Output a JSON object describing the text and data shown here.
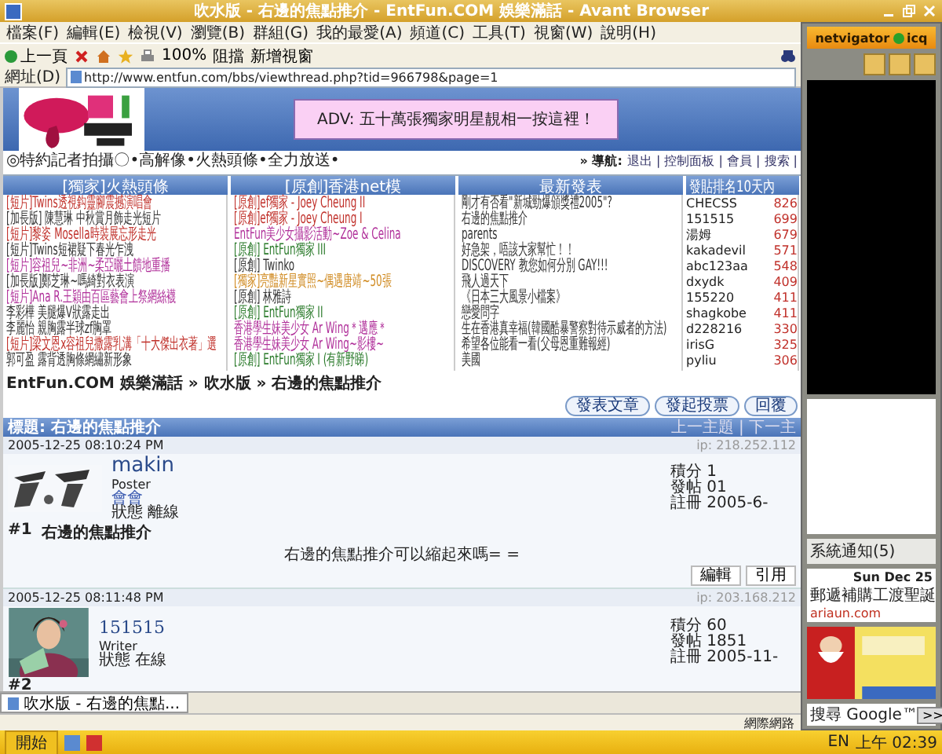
{
  "window": {
    "title": "吹水版 - 右邊的焦點推介 - EntFun.COM 娛樂滿話 - Avant Browser"
  },
  "menu": [
    "檔案(F)",
    "編輯(E)",
    "檢視(V)",
    "瀏覽(B)",
    "群組(G)",
    "我的最愛(A)",
    "頻道(C)",
    "工具(T)",
    "視窗(W)",
    "說明(H)"
  ],
  "toolbar": {
    "back": "上一頁",
    "zoom": "100%",
    "block": "阻擋",
    "new_window": "新增視窗"
  },
  "address": {
    "label": "網址(D)",
    "value": "http://www.entfun.com/bbs/viewthread.php?tid=966798&page=1"
  },
  "banner": {
    "ad": "ADV: 五十萬張獨家明星靚相一按這裡！"
  },
  "nav": {
    "slogan": "◎特約記者拍攝〇•高解像•火熱頭條•全力放送•",
    "label": "» 導航:",
    "links": "退出 | 控制面板 | 會員 | 搜索 |"
  },
  "boxes": [
    {
      "title": "[獨家]火熱頭條",
      "items": [
        {
          "text": "[短片]Twins透視鈎靈腳震撼演唱會",
          "color": "#c0302a"
        },
        {
          "text": "[加長版] 陳慧琳 中秋賞月飾走光短片",
          "color": "#333333"
        },
        {
          "text": "[短片]黎姿 Mosella時裝展忘形走光",
          "color": "#c0302a"
        },
        {
          "text": "[短片]Twins短裙疑下春光乍洩",
          "color": "#333333"
        },
        {
          "text": "[短片]容祖兒~非洲~柔亞曬土饋地重播",
          "color": "#b0309a"
        },
        {
          "text": "[加長版]鄭芝琳~嗎綺對衣表演",
          "color": "#333333"
        },
        {
          "text": "[短片]Ana R.王穎由百區藝會上祭網絲襪",
          "color": "#b0309a"
        },
        {
          "text": "李彩樺 美腿爆V狀露走出",
          "color": "#333333"
        },
        {
          "text": "李麗怡 親胸露半球zf胸罩",
          "color": "#333333"
        },
        {
          "text": "[短片]梁文恩x容祖兒撒露乳溝「十大傑出衣著」選",
          "color": "#c0302a"
        },
        {
          "text": "郭可盈 露背透胸條網繡新形象",
          "color": "#333333"
        }
      ]
    },
    {
      "title": "[原創]香港net模",
      "items": [
        {
          "text": "[原創]ef獨家 - Joey Cheung II",
          "color": "#c0302a"
        },
        {
          "text": "[原創]ef獨家 - Joey Cheung I",
          "color": "#c0302a"
        },
        {
          "text": "EntFun美少女攝影活動~Zoe & Celina",
          "color": "#b0309a"
        },
        {
          "text": "[原創] EntFun獨家 III",
          "color": "#2a7a2a"
        },
        {
          "text": "[原創] Twinko",
          "color": "#333333"
        },
        {
          "text": "[獨家]亮豔新星實照~偶遇唐靖~50張",
          "color": "#d08a20"
        },
        {
          "text": "[原創] 林雅詩",
          "color": "#333333"
        },
        {
          "text": "[原創] EntFun獨家 II",
          "color": "#2a7a2a"
        },
        {
          "text": "香港學生妹美少女 Ar Wing＊邁應＊",
          "color": "#b0309a"
        },
        {
          "text": "香港學生妹美少女 Ar Wing~影樓~",
          "color": "#b0309a"
        },
        {
          "text": "[原創] EntFun獨家 I (有新野睇)",
          "color": "#2a7a2a"
        }
      ]
    },
    {
      "title": "最新發表",
      "items": [
        {
          "text": "剛才有否看\"新城勁爆頒獎禮2005\"?",
          "color": "#333333"
        },
        {
          "text": "右邊的焦點推介",
          "color": "#333333"
        },
        {
          "text": "parents",
          "color": "#333333"
        },
        {
          "text": "好急架，唔該大家幫忙！！",
          "color": "#333333"
        },
        {
          "text": "DISCOVERY 教您如何分別 GAY!!!",
          "color": "#333333"
        },
        {
          "text": "飛人過天下",
          "color": "#333333"
        },
        {
          "text": "《日本三大風景小檔案》",
          "color": "#333333"
        },
        {
          "text": "戀愛問字",
          "color": "#333333"
        },
        {
          "text": "生在香港真幸福(韓國酷暴警察對待示威者的方法)",
          "color": "#333333"
        },
        {
          "text": "希望各位能看一看(父母恩重難報經)",
          "color": "#333333"
        },
        {
          "text": "美國",
          "color": "#333333"
        }
      ]
    }
  ],
  "ranking": {
    "title": "發貼排名10天內",
    "items": [
      {
        "name": "CHECSS",
        "count": "826"
      },
      {
        "name": "151515",
        "count": "699"
      },
      {
        "name": "湯姆",
        "count": "679"
      },
      {
        "name": "kakadevil",
        "count": "571"
      },
      {
        "name": "abc123aa",
        "count": "548"
      },
      {
        "name": "dxydk",
        "count": "409"
      },
      {
        "name": "155220",
        "count": "411"
      },
      {
        "name": "shagkobe",
        "count": "411"
      },
      {
        "name": "d228216",
        "count": "330"
      },
      {
        "name": "irisG",
        "count": "325"
      },
      {
        "name": "pyliu",
        "count": "306"
      }
    ]
  },
  "breadcrumb": "EntFun.COM 娛樂滿話 » 吹水版 » 右邊的焦點推介",
  "actions": [
    "發表文章",
    "發起投票",
    "回覆"
  ],
  "thread": {
    "title": "標題: 右邊的焦點推介",
    "nav": "上一主題 | 下一主"
  },
  "posts": [
    {
      "date": "2005-12-25 08:10:24 PM",
      "ip": "ip: 218.252.112",
      "kind": "calligraphy",
      "author": "makin",
      "rank": "Poster",
      "group": "會會",
      "status": "狀態 離線",
      "stats": [
        "積分 1",
        "發帖 01",
        "註冊 2005-6-"
      ],
      "number": "#1",
      "subject": "右邊的焦點推介",
      "body": "右邊的焦點推介可以縮起來嗎= =",
      "buttons": [
        "編輯",
        "引用"
      ]
    },
    {
      "date": "2005-12-25 08:11:48 PM",
      "ip": "ip: 203.168.212",
      "kind": "portrait",
      "author": "151515",
      "rank": "Writer",
      "status": "狀態 在線",
      "stats": [
        "積分 60",
        "發帖 1851",
        "註冊 2005-11-"
      ],
      "number": "#2"
    }
  ],
  "sidebar": {
    "logo": "netvigator",
    "logo2": "icq",
    "notice": "系統通知(5)",
    "date": "Sun Dec 25",
    "headline": "郵遞補購工渡聖誕",
    "site": "ariaun.com",
    "search": "搜尋 Google™",
    "go": ">>"
  },
  "tab": "吹水版 - 右邊的焦點...",
  "status": "網際網路",
  "taskbar": {
    "start": "開始",
    "lang": "EN",
    "clock": "上午 02:39"
  }
}
